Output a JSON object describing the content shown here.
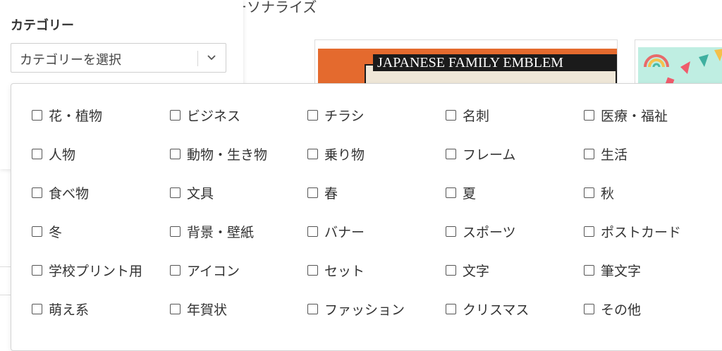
{
  "background": {
    "title_fragment": "ーソナライズ",
    "card_text": "JAPANESE FAMILY EMBLEM"
  },
  "category": {
    "label": "カテゴリー",
    "select_placeholder": "カテゴリーを選択",
    "options": [
      "花・植物",
      "ビジネス",
      "チラシ",
      "名刺",
      "医療・福祉",
      "人物",
      "動物・生き物",
      "乗り物",
      "フレーム",
      "生活",
      "食べ物",
      "文具",
      "春",
      "夏",
      "秋",
      "冬",
      "背景・壁紙",
      "バナー",
      "スポーツ",
      "ポストカード",
      "学校プリント用",
      "アイコン",
      "セット",
      "文字",
      "筆文字",
      "萌え系",
      "年賀状",
      "ファッション",
      "クリスマス",
      "その他"
    ]
  },
  "colors": {
    "emblem_orange": "#e46a2e",
    "party_mint": "#bfeee2",
    "border": "#d4d4d4"
  }
}
